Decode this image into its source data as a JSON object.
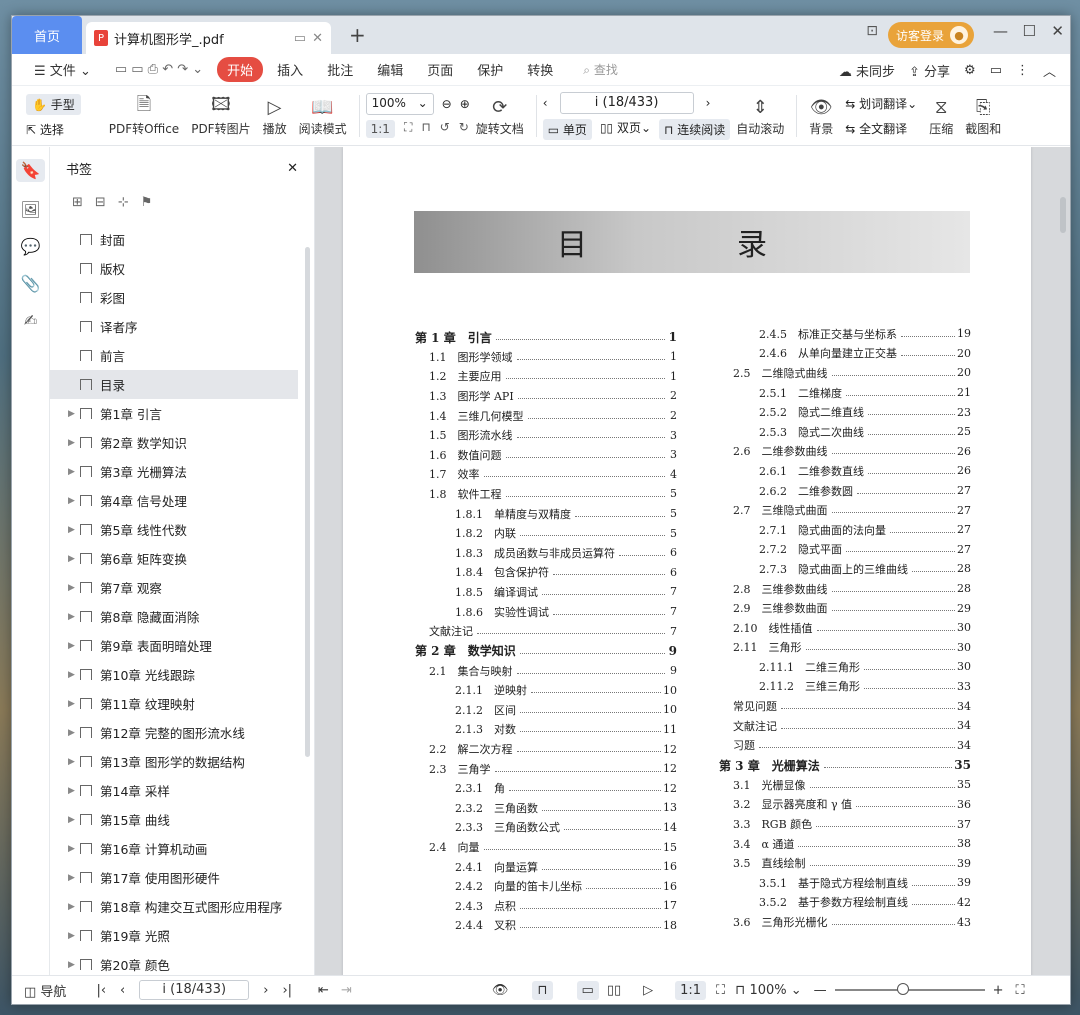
{
  "tabs": {
    "home": "首页",
    "doc": "计算机图形学_.pdf",
    "add": "+"
  },
  "login": "访客登录",
  "menu": {
    "file": "文件",
    "items": [
      "开始",
      "插入",
      "批注",
      "编辑",
      "页面",
      "保护",
      "转换"
    ],
    "search": "查找",
    "sync": "未同步",
    "share": "分享"
  },
  "toolbar": {
    "hand": "手型",
    "select": "选择",
    "to_office": "PDF转Office",
    "to_image": "PDF转图片",
    "play": "播放",
    "read_mode": "阅读模式",
    "zoom": "100%",
    "page": "i (18/433)",
    "rotate": "旋转文档",
    "single": "单页",
    "double": "双页",
    "continuous": "连续阅读",
    "autoscroll": "自动滚动",
    "background": "背景",
    "word_translate": "划词翻译",
    "full_translate": "全文翻译",
    "compress": "压缩",
    "screenshot": "截图和"
  },
  "panel": {
    "title": "书签",
    "items": [
      {
        "label": "封面",
        "expand": false
      },
      {
        "label": "版权",
        "expand": false
      },
      {
        "label": "彩图",
        "expand": false
      },
      {
        "label": "译者序",
        "expand": false
      },
      {
        "label": "前言",
        "expand": false
      },
      {
        "label": "目录",
        "expand": false,
        "selected": true
      },
      {
        "label": "第1章 引言",
        "expand": true
      },
      {
        "label": "第2章 数学知识",
        "expand": true
      },
      {
        "label": "第3章 光栅算法",
        "expand": true
      },
      {
        "label": "第4章 信号处理",
        "expand": true
      },
      {
        "label": "第5章 线性代数",
        "expand": true
      },
      {
        "label": "第6章 矩阵变换",
        "expand": true
      },
      {
        "label": "第7章 观察",
        "expand": true
      },
      {
        "label": "第8章 隐藏面消除",
        "expand": true
      },
      {
        "label": "第9章 表面明暗处理",
        "expand": true
      },
      {
        "label": "第10章 光线跟踪",
        "expand": true
      },
      {
        "label": "第11章 纹理映射",
        "expand": true
      },
      {
        "label": "第12章 完整的图形流水线",
        "expand": true
      },
      {
        "label": "第13章 图形学的数据结构",
        "expand": true
      },
      {
        "label": "第14章 采样",
        "expand": true
      },
      {
        "label": "第15章 曲线",
        "expand": true
      },
      {
        "label": "第16章 计算机动画",
        "expand": true
      },
      {
        "label": "第17章 使用图形硬件",
        "expand": true
      },
      {
        "label": "第18章 构建交互式图形应用程序",
        "expand": true
      },
      {
        "label": "第19章 光照",
        "expand": true
      },
      {
        "label": "第20章 颜色",
        "expand": true
      }
    ]
  },
  "toc": {
    "title": "目　录",
    "left": [
      {
        "t": "第 1 章　引言",
        "p": "1",
        "lv": 0
      },
      {
        "t": "1.1　图形学领域",
        "p": "1",
        "lv": 1
      },
      {
        "t": "1.2　主要应用",
        "p": "1",
        "lv": 1
      },
      {
        "t": "1.3　图形学 API",
        "p": "2",
        "lv": 1
      },
      {
        "t": "1.4　三维几何模型",
        "p": "2",
        "lv": 1
      },
      {
        "t": "1.5　图形流水线",
        "p": "3",
        "lv": 1
      },
      {
        "t": "1.6　数值问题",
        "p": "3",
        "lv": 1
      },
      {
        "t": "1.7　效率",
        "p": "4",
        "lv": 1
      },
      {
        "t": "1.8　软件工程",
        "p": "5",
        "lv": 1
      },
      {
        "t": "1.8.1　单精度与双精度",
        "p": "5",
        "lv": 2
      },
      {
        "t": "1.8.2　内联",
        "p": "5",
        "lv": 2
      },
      {
        "t": "1.8.3　成员函数与非成员运算符",
        "p": "6",
        "lv": 2
      },
      {
        "t": "1.8.4　包含保护符",
        "p": "6",
        "lv": 2
      },
      {
        "t": "1.8.5　编译调试",
        "p": "7",
        "lv": 2
      },
      {
        "t": "1.8.6　实验性调试",
        "p": "7",
        "lv": 2
      },
      {
        "t": "文献注记",
        "p": "7",
        "lv": 1
      },
      {
        "t": "第 2 章　数学知识",
        "p": "9",
        "lv": 0
      },
      {
        "t": "2.1　集合与映射",
        "p": "9",
        "lv": 1
      },
      {
        "t": "2.1.1　逆映射",
        "p": "10",
        "lv": 2
      },
      {
        "t": "2.1.2　区间",
        "p": "10",
        "lv": 2
      },
      {
        "t": "2.1.3　对数",
        "p": "11",
        "lv": 2
      },
      {
        "t": "2.2　解二次方程",
        "p": "12",
        "lv": 1
      },
      {
        "t": "2.3　三角学",
        "p": "12",
        "lv": 1
      },
      {
        "t": "2.3.1　角",
        "p": "12",
        "lv": 2
      },
      {
        "t": "2.3.2　三角函数",
        "p": "13",
        "lv": 2
      },
      {
        "t": "2.3.3　三角函数公式",
        "p": "14",
        "lv": 2
      },
      {
        "t": "2.4　向量",
        "p": "15",
        "lv": 1
      },
      {
        "t": "2.4.1　向量运算",
        "p": "16",
        "lv": 2
      },
      {
        "t": "2.4.2　向量的笛卡儿坐标",
        "p": "16",
        "lv": 2
      },
      {
        "t": "2.4.3　点积",
        "p": "17",
        "lv": 2
      },
      {
        "t": "2.4.4　叉积",
        "p": "18",
        "lv": 2
      }
    ],
    "right": [
      {
        "t": "2.4.5　标准正交基与坐标系",
        "p": "19",
        "lv": 2
      },
      {
        "t": "2.4.6　从单向量建立正交基",
        "p": "20",
        "lv": 2
      },
      {
        "t": "2.5　二维隐式曲线",
        "p": "20",
        "lv": 1
      },
      {
        "t": "2.5.1　二维梯度",
        "p": "21",
        "lv": 2
      },
      {
        "t": "2.5.2　隐式二维直线",
        "p": "23",
        "lv": 2
      },
      {
        "t": "2.5.3　隐式二次曲线",
        "p": "25",
        "lv": 2
      },
      {
        "t": "2.6　二维参数曲线",
        "p": "26",
        "lv": 1
      },
      {
        "t": "2.6.1　二维参数直线",
        "p": "26",
        "lv": 2
      },
      {
        "t": "2.6.2　二维参数圆",
        "p": "27",
        "lv": 2
      },
      {
        "t": "2.7　三维隐式曲面",
        "p": "27",
        "lv": 1
      },
      {
        "t": "2.7.1　隐式曲面的法向量",
        "p": "27",
        "lv": 2
      },
      {
        "t": "2.7.2　隐式平面",
        "p": "27",
        "lv": 2
      },
      {
        "t": "2.7.3　隐式曲面上的三维曲线",
        "p": "28",
        "lv": 2
      },
      {
        "t": "2.8　三维参数曲线",
        "p": "28",
        "lv": 1
      },
      {
        "t": "2.9　三维参数曲面",
        "p": "29",
        "lv": 1
      },
      {
        "t": "2.10　线性插值",
        "p": "30",
        "lv": 1
      },
      {
        "t": "2.11　三角形",
        "p": "30",
        "lv": 1
      },
      {
        "t": "2.11.1　二维三角形",
        "p": "30",
        "lv": 3
      },
      {
        "t": "2.11.2　三维三角形",
        "p": "33",
        "lv": 3
      },
      {
        "t": "常见问题",
        "p": "34",
        "lv": 1
      },
      {
        "t": "文献注记",
        "p": "34",
        "lv": 1
      },
      {
        "t": "习题",
        "p": "34",
        "lv": 1
      },
      {
        "t": "第 3 章　光栅算法",
        "p": "35",
        "lv": 0
      },
      {
        "t": "3.1　光栅显像",
        "p": "35",
        "lv": 1
      },
      {
        "t": "3.2　显示器亮度和 γ 值",
        "p": "36",
        "lv": 1
      },
      {
        "t": "3.3　RGB 颜色",
        "p": "37",
        "lv": 1
      },
      {
        "t": "3.4　α 通道",
        "p": "38",
        "lv": 1
      },
      {
        "t": "3.5　直线绘制",
        "p": "39",
        "lv": 1
      },
      {
        "t": "3.5.1　基于隐式方程绘制直线",
        "p": "39",
        "lv": 2
      },
      {
        "t": "3.5.2　基于参数方程绘制直线",
        "p": "42",
        "lv": 2
      },
      {
        "t": "3.6　三角形光栅化",
        "p": "43",
        "lv": 1
      }
    ]
  },
  "status": {
    "nav": "导航",
    "page": "i (18/433)",
    "zoom": "100%"
  }
}
